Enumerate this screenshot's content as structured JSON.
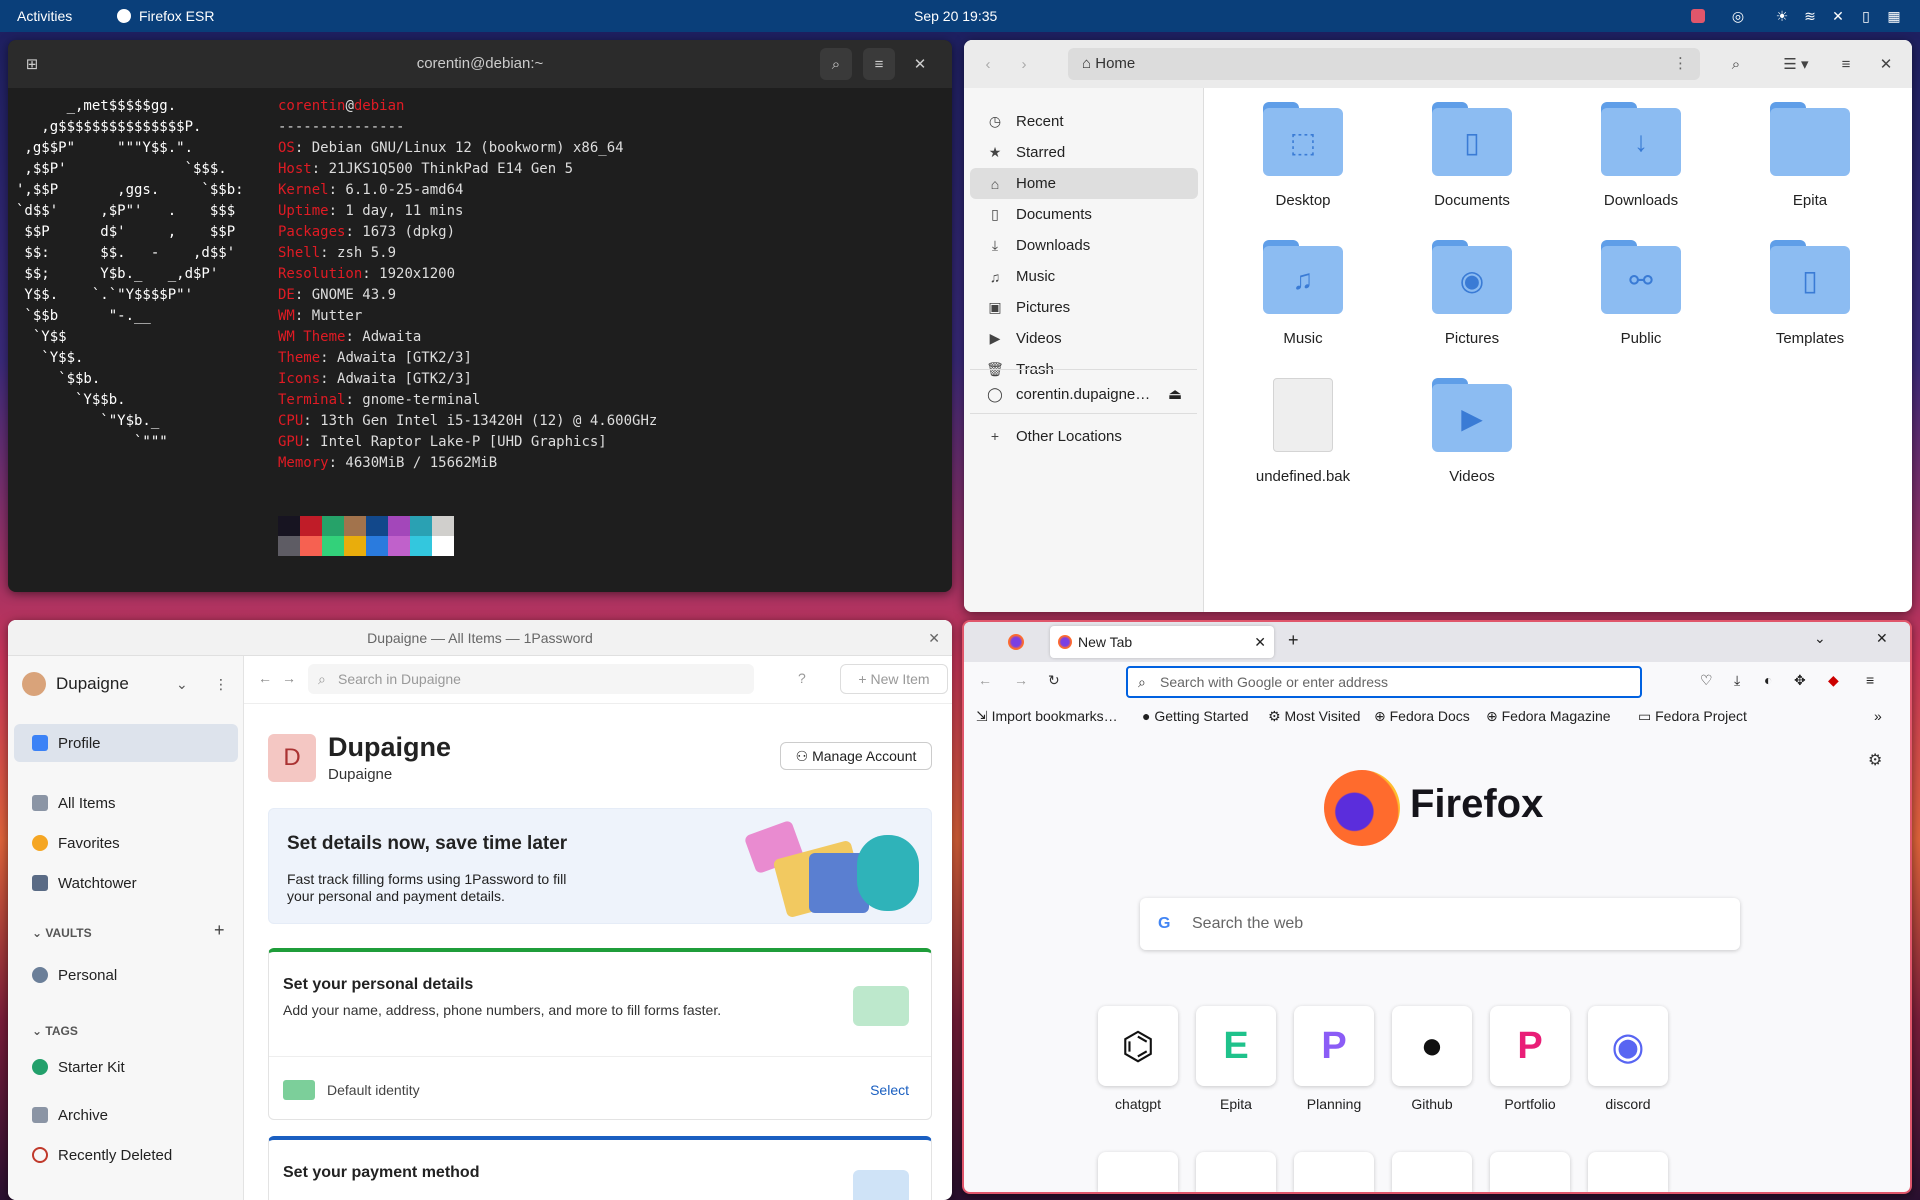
{
  "topbar": {
    "activities": "Activities",
    "app": "Firefox ESR",
    "clock": "Sep 20  19:35"
  },
  "terminal": {
    "title": "corentin@debian:~",
    "logo": "      _,met$$$$$gg.\n   ,g$$$$$$$$$$$$$$$P.\n ,g$$P\"     \"\"\"Y$$.\".\n ,$$P'              `$$$.\n',$$P       ,ggs.     `$$b:\n`d$$'     ,$P\"'   .    $$$\n $$P      d$'     ,    $$P\n $$:      $$.   -    ,d$$'\n $$;      Y$b._   _,d$P'\n Y$$.    `.`\"Y$$$$P\"'\n `$$b      \"-.__\n  `Y$$\n   `Y$$.\n     `$$b.\n       `Y$$b.\n          `\"Y$b._\n              `\"\"\"",
    "user": "corentin",
    "at": "@",
    "host": "debian",
    "sep": "---------------",
    "info": [
      [
        "OS",
        ": Debian GNU/Linux 12 (bookworm) x86_64"
      ],
      [
        "Host",
        ": 21JKS1Q500 ThinkPad E14 Gen 5"
      ],
      [
        "Kernel",
        ": 6.1.0-25-amd64"
      ],
      [
        "Uptime",
        ": 1 day, 11 mins"
      ],
      [
        "Packages",
        ": 1673 (dpkg)"
      ],
      [
        "Shell",
        ": zsh 5.9"
      ],
      [
        "Resolution",
        ": 1920x1200"
      ],
      [
        "DE",
        ": GNOME 43.9"
      ],
      [
        "WM",
        ": Mutter"
      ],
      [
        "WM Theme",
        ": Adwaita"
      ],
      [
        "Theme",
        ": Adwaita [GTK2/3]"
      ],
      [
        "Icons",
        ": Adwaita [GTK2/3]"
      ],
      [
        "Terminal",
        ": gnome-terminal"
      ],
      [
        "CPU",
        ": 13th Gen Intel i5-13420H (12) @ 4.600GHz"
      ],
      [
        "GPU",
        ": Intel Raptor Lake-P [UHD Graphics]"
      ],
      [
        "Memory",
        ": 4630MiB / 15662MiB"
      ]
    ],
    "palette_top": [
      "#171421",
      "#c01c28",
      "#26a269",
      "#a2734c",
      "#12488b",
      "#a347ba",
      "#2aa1b3",
      "#d0cfcc"
    ],
    "palette_bottom": [
      "#5e5c64",
      "#f66151",
      "#33d17a",
      "#e9ad0c",
      "#2a7bde",
      "#c061cb",
      "#33c7de",
      "#ffffff"
    ],
    "prompt": "→  ~ "
  },
  "files": {
    "location": "Home",
    "sidebar": [
      {
        "label": "Recent",
        "icon": "clock-icon"
      },
      {
        "label": "Starred",
        "icon": "star-icon"
      },
      {
        "label": "Home",
        "icon": "home-icon"
      },
      {
        "label": "Documents",
        "icon": "document-icon"
      },
      {
        "label": "Downloads",
        "icon": "download-icon"
      },
      {
        "label": "Music",
        "icon": "music-icon"
      },
      {
        "label": "Pictures",
        "icon": "picture-icon"
      },
      {
        "label": "Videos",
        "icon": "video-icon"
      },
      {
        "label": "Trash",
        "icon": "trash-icon"
      }
    ],
    "mount": "corentin.dupaigne…",
    "other": "Other Locations",
    "folders": [
      "Desktop",
      "Documents",
      "Downloads",
      "Epita",
      "Music",
      "Pictures",
      "Public",
      "Templates",
      "undefined.bak",
      "Videos"
    ]
  },
  "op": {
    "title": "Dupaigne — All Items — 1Password",
    "account": "Dupaigne",
    "search_ph": "Search in Dupaigne",
    "new_item": "New Item",
    "nav": [
      "Profile",
      "All Items",
      "Favorites",
      "Watchtower"
    ],
    "vaults_h": "VAULTS",
    "vault": "Personal",
    "tags_h": "TAGS",
    "tag": "Starter Kit",
    "archive": "Archive",
    "deleted": "Recently Deleted",
    "avatar_letter": "D",
    "name": "Dupaigne",
    "sub": "Dupaigne",
    "manage": "Manage Account",
    "banner_title": "Set details now, save time later",
    "banner_text": "Fast track filling forms using 1Password to fill your personal and payment details.",
    "card1_title": "Set your personal details",
    "card1_text": "Add your name, address, phone numbers, and more to fill forms faster.",
    "identity": "Default identity",
    "select": "Select",
    "card2_title": "Set your payment method"
  },
  "ff": {
    "tab": "New Tab",
    "address_ph": "Search with Google or enter address",
    "bookmarks": [
      "Import bookmarks…",
      "Getting Started",
      "Most Visited",
      "Fedora Docs",
      "Fedora Magazine",
      "Fedora Project"
    ],
    "brand": "Firefox",
    "search_ph": "Search the web",
    "sites": [
      {
        "label": "chatgpt",
        "glyph": "⌬",
        "color": "#111"
      },
      {
        "label": "Epita",
        "glyph": "E",
        "color": "#1fc28b"
      },
      {
        "label": "Planning",
        "glyph": "P",
        "color": "#8b5cf6"
      },
      {
        "label": "Github",
        "glyph": "●",
        "color": "#111"
      },
      {
        "label": "Portfolio",
        "glyph": "P",
        "color": "#e91e77"
      },
      {
        "label": "discord",
        "glyph": "◉",
        "color": "#5865f2"
      }
    ]
  }
}
